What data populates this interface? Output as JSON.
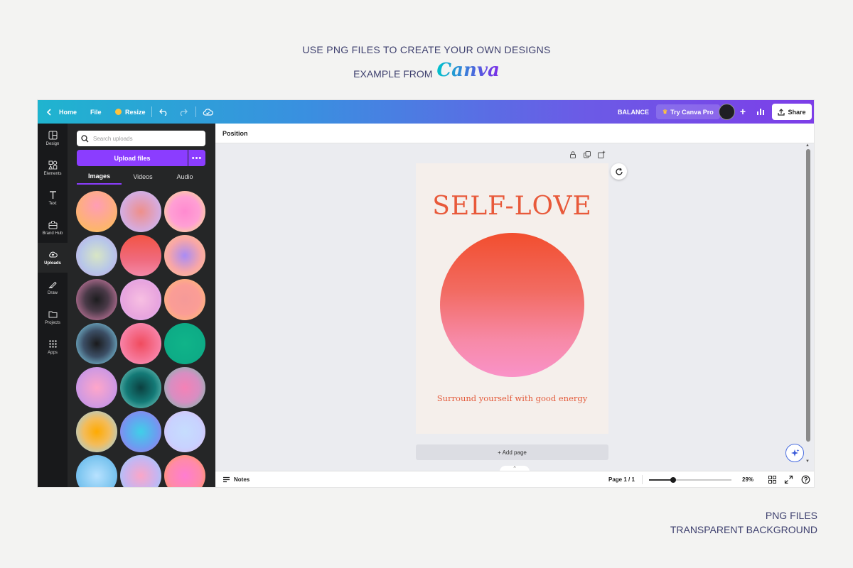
{
  "promo": {
    "line1": "USE PNG FILES TO CREATE YOUR OWN DESIGNS",
    "line2": "EXAMPLE FROM",
    "brand": "Canva",
    "footer1": "PNG FILES",
    "footer2": "TRANSPARENT BACKGROUND"
  },
  "topbar": {
    "home": "Home",
    "file": "File",
    "resize": "Resize",
    "doc_title": "BALANCE",
    "try_pro": "Try Canva Pro",
    "share": "Share"
  },
  "rail": {
    "items": [
      "Design",
      "Elements",
      "Text",
      "Brand Hub",
      "Uploads",
      "Draw",
      "Projects",
      "Apps"
    ],
    "active": "Uploads"
  },
  "panel": {
    "search_placeholder": "Search uploads",
    "upload_label": "Upload files",
    "more_label": "•••",
    "tabs": [
      "Images",
      "Videos",
      "Audio"
    ],
    "active_tab": "Images"
  },
  "uploads": [
    "radial-gradient(circle at 50% 35%, #ff9db5 0%, #fdb46e 70%, #ffd25e 100%)",
    "radial-gradient(circle, #ee8f8a 0%, #d8a9d8 60%, #b8c5ff 100%)",
    "radial-gradient(circle, #ff8ad0 0%, #ff9fd4 50%, #f6f07a 100%)",
    "radial-gradient(circle, #d8e6c4 0%, #b8c7e8 55%, #bfa5e8 100%)",
    "linear-gradient(180deg, #f25445 0%, #f06a7d 60%, #f389a8 100%)",
    "radial-gradient(circle, #a98cf5 0%, #f7a6a8 55%, #ffc48a 100%)",
    "radial-gradient(circle, #1d1d1f 0%, #4a3a48 40%, #e98ab8 100%)",
    "radial-gradient(circle, #f7bfe2 0%, #e8a5de 60%, #d5b3ff 100%)",
    "radial-gradient(circle, #f59a98 0%, #fb9d96 50%, #ffc36b 100%)",
    "radial-gradient(circle, #1a1a1c 0%, #3c4f66 45%, #8ee6ff 100%)",
    "radial-gradient(circle, #f04b5e 0%, #f67a9c 60%, #ff9bc9 100%)",
    "radial-gradient(circle, #10b489 0%, #0dab86 70%, #0a9f7a 100%)",
    "radial-gradient(circle, #ffa6c9 0%, #d39ae0 60%, #b488f0 100%)",
    "radial-gradient(circle, #0b3f3f 0%, #147a77 50%, #8bd8cf 100%)",
    "radial-gradient(circle, #f581b6 0%, #d78ec2 50%, #66c7a8 100%)",
    "radial-gradient(circle, #ffaa00 0%, #f3bc5b 45%, #94d4ff 100%)",
    "radial-gradient(circle, #3fd0e8 0%, #6c9df0 55%, #b072e8 100%)",
    "radial-gradient(circle, #c6ddfd 0%, #c8d2ff 55%, #e3b7ec 100%)",
    "radial-gradient(circle, #b8e2ff 0%, #7ec6f0 60%, #5aa8e8 100%)",
    "radial-gradient(circle, #fba6c8 0%, #c7b5f0 55%, #8ed4ff 100%)",
    "radial-gradient(circle, #ff7dd1 0%, #ff8aa8 55%, #ff9d3a 100%)"
  ],
  "editor": {
    "context_label": "Position",
    "design_title": "SELF-LOVE",
    "design_tagline": "Surround yourself with good energy",
    "add_page": "+ Add page"
  },
  "bottombar": {
    "notes": "Notes",
    "page_info": "Page 1 / 1",
    "zoom": "29%",
    "zoom_fraction": 0.29
  },
  "colors": {
    "accent_purple": "#8b3dff",
    "title_red": "#e8593a"
  }
}
